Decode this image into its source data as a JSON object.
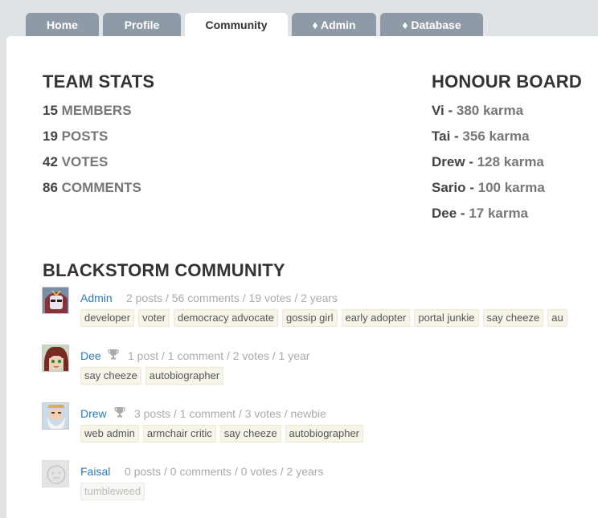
{
  "tabs": [
    {
      "label": "Home"
    },
    {
      "label": "Profile"
    },
    {
      "label": "Community"
    },
    {
      "label": "♦ Admin"
    },
    {
      "label": "♦ Database"
    }
  ],
  "team_stats": {
    "title": "TEAM STATS",
    "items": [
      {
        "value": "15",
        "label": "MEMBERS"
      },
      {
        "value": "19",
        "label": "POSTS"
      },
      {
        "value": "42",
        "label": "VOTES"
      },
      {
        "value": "86",
        "label": "COMMENTS"
      }
    ]
  },
  "honour_board": {
    "title": "HONOUR BOARD",
    "items": [
      {
        "name": "Vi -",
        "karma": "380 karma"
      },
      {
        "name": "Tai -",
        "karma": "356 karma"
      },
      {
        "name": "Drew -",
        "karma": "128 karma"
      },
      {
        "name": "Sario -",
        "karma": "100 karma"
      },
      {
        "name": "Dee -",
        "karma": "17 karma"
      }
    ]
  },
  "community": {
    "title": "BLACKSTORM COMMUNITY",
    "members": [
      {
        "name": "Admin",
        "stats": "2 posts / 56 comments / 19 votes / 2 years",
        "trophy": false,
        "badges": [
          "developer",
          "voter",
          "democracy advocate",
          "gossip girl",
          "early adopter",
          "portal junkie",
          "say cheeze",
          "au"
        ]
      },
      {
        "name": "Dee",
        "stats": "1 post / 1 comment / 2 votes / 1 year",
        "trophy": true,
        "badges": [
          "say cheeze",
          "autobiographer"
        ]
      },
      {
        "name": "Drew",
        "stats": "3 posts / 1 comment / 3 votes / newbie",
        "trophy": true,
        "badges": [
          "web admin",
          "armchair critic",
          "say cheeze",
          "autobiographer"
        ]
      },
      {
        "name": "Faisal",
        "stats": "0 posts / 0 comments / 0 votes / 2 years",
        "trophy": false,
        "badges": [
          "tumbleweed"
        ]
      }
    ]
  },
  "icons": {
    "trophy": "trophy-icon",
    "avatar": "avatar"
  },
  "colors": {
    "tab_bg": "#8e9ba6",
    "link": "#2e7ab5",
    "badge_bg": "#f6f5e8"
  }
}
